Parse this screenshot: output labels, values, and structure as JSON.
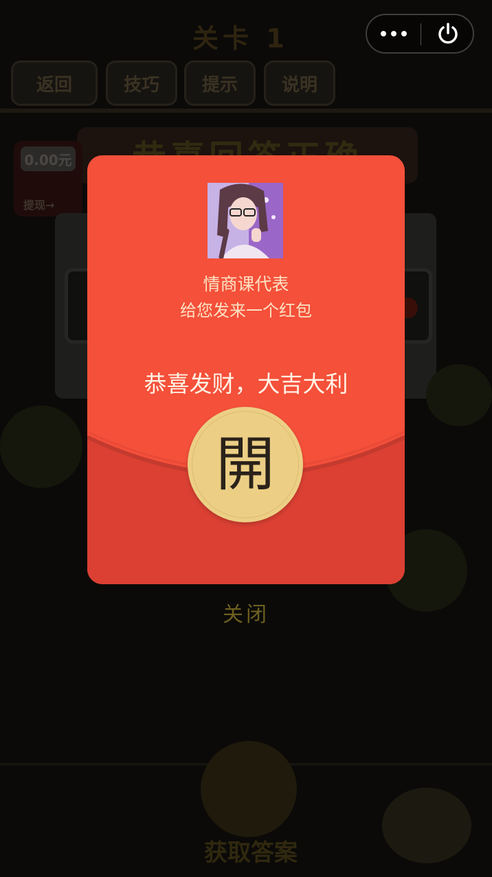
{
  "background": {
    "title": "关卡 1",
    "nav_buttons": [
      "返回",
      "技巧",
      "提示",
      "说明"
    ],
    "banner": "恭喜回答正确",
    "money": {
      "amount": "0.00元",
      "action": "提现→"
    },
    "bottom_label": "获取答案"
  },
  "capsule": {
    "more_icon": "more-dots-icon",
    "close_icon": "power-icon"
  },
  "red_packet": {
    "sender": "情商课代表",
    "subtitle": "给您发来一个红包",
    "blessing": "恭喜发财，大吉大利",
    "open_label": "開",
    "close_label": "关闭",
    "colors": {
      "top": "#f4503a",
      "bottom": "#db4033",
      "open_button": "#eccf85",
      "text": "#fde2c4"
    }
  }
}
